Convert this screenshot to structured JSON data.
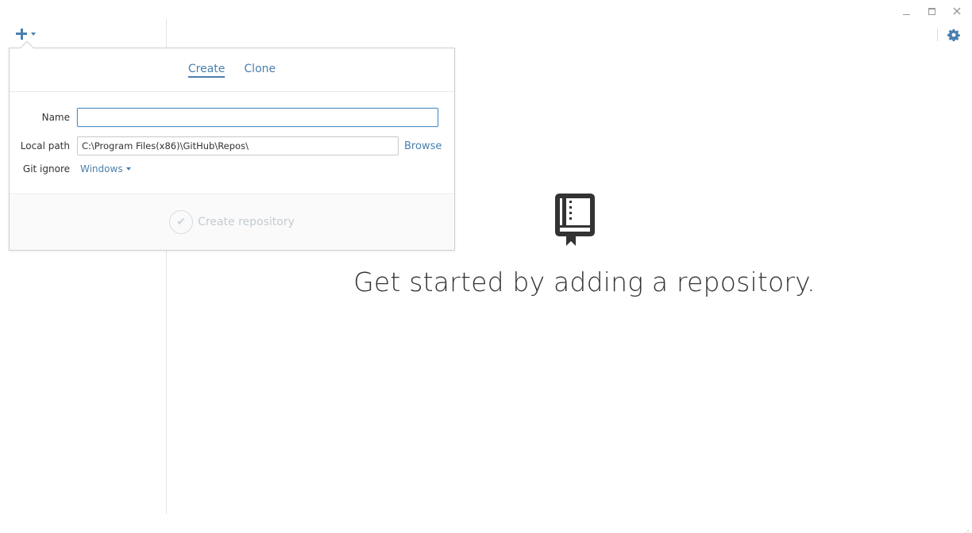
{
  "toolbar": {
    "add_icon": "plus-icon",
    "add_caret_icon": "caret-down-icon",
    "settings_icon": "gear-icon"
  },
  "window": {
    "minimize_icon": "minimize-icon",
    "maximize_icon": "maximize-icon",
    "close_icon": "close-icon"
  },
  "popup": {
    "tabs": [
      {
        "label": "Create",
        "active": true
      },
      {
        "label": "Clone",
        "active": false
      }
    ],
    "fields": {
      "name_label": "Name",
      "name_value": "",
      "local_path_label": "Local path",
      "local_path_value": "C:\\Program Files(x86)\\GitHub\\Repos\\",
      "browse_label": "Browse",
      "gitignore_label": "Git ignore",
      "gitignore_value": "Windows"
    },
    "create_button_label": "Create repository",
    "create_button_enabled": false
  },
  "empty_state": {
    "icon": "repository-book-icon",
    "message": "Get started by adding a repository."
  },
  "colors": {
    "accent": "#4a7fad",
    "disabled": "#c3ccd3",
    "text": "#333333"
  }
}
